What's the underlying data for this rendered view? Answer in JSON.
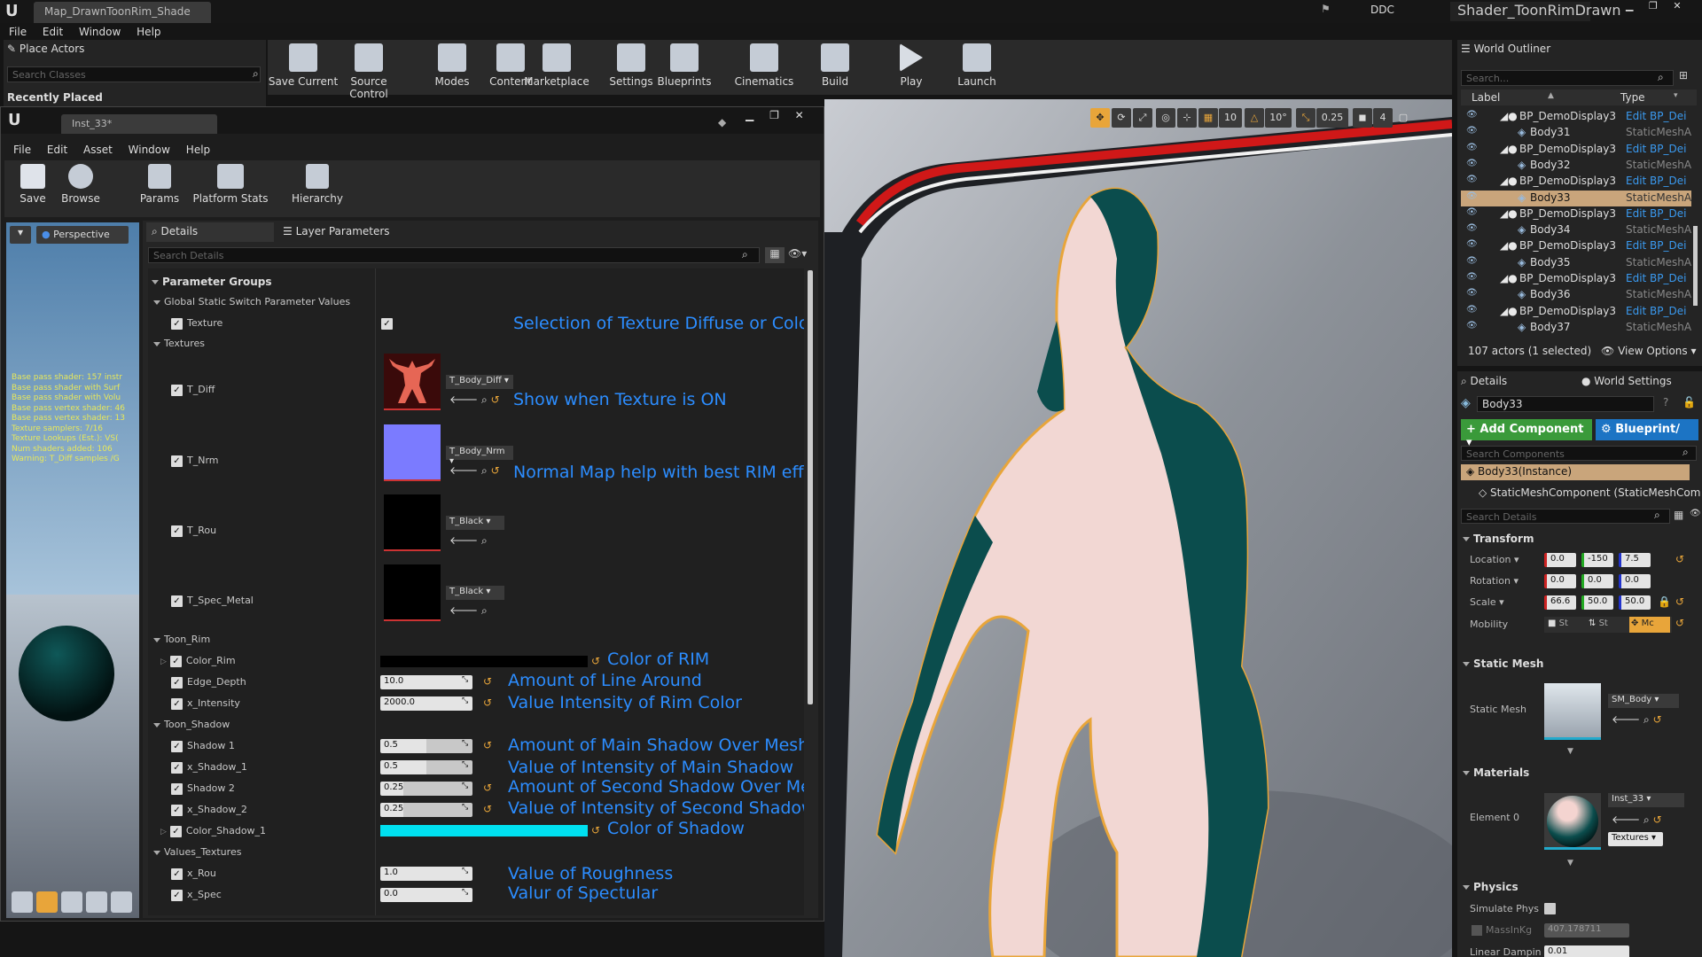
{
  "app": {
    "window_tab": "Map_DrawnToonRim_Shade",
    "ddc": "DDC",
    "project_name": "Shader_ToonRimDrawn",
    "menu": [
      "File",
      "Edit",
      "Window",
      "Help"
    ]
  },
  "place_actors": {
    "tab": "Place Actors",
    "search_placeholder": "Search Classes",
    "recently_placed": "Recently Placed"
  },
  "main_toolbar": [
    {
      "label": "Save Current",
      "icon": "save-icon"
    },
    {
      "label": "Source Control",
      "icon": "source-control-icon"
    },
    {
      "label": "Modes",
      "icon": "modes-icon"
    },
    {
      "label": "Content",
      "icon": "content-icon"
    },
    {
      "label": "Marketplace",
      "icon": "marketplace-icon"
    },
    {
      "label": "Settings",
      "icon": "settings-icon"
    },
    {
      "label": "Blueprints",
      "icon": "blueprints-icon"
    },
    {
      "label": "Cinematics",
      "icon": "cinematics-icon"
    },
    {
      "label": "Build",
      "icon": "build-icon"
    },
    {
      "label": "Play",
      "icon": "play-icon"
    },
    {
      "label": "Launch",
      "icon": "launch-icon"
    }
  ],
  "viewport_toolbar": {
    "grid": "10",
    "rotation": "10°",
    "scale": "0.25",
    "camera_speed": "4"
  },
  "material_editor": {
    "tab": "Inst_33*",
    "menu": [
      "File",
      "Edit",
      "Asset",
      "Window",
      "Help"
    ],
    "toolbar": [
      "Save",
      "Browse",
      "Params",
      "Platform Stats",
      "Hierarchy"
    ],
    "perspective": "Perspective",
    "stats": [
      "Base pass shader: 157 instr",
      "Base pass shader with Surf",
      "Base pass shader with Volu",
      "Base pass vertex shader: 46",
      "Base pass vertex shader: 13",
      "Texture samplers: 7/16",
      "Texture Lookups (Est.): VS(",
      "Num shaders added: 106",
      "Warning: T_Diff samples /G"
    ],
    "tabs": [
      "Details",
      "Layer Parameters"
    ],
    "search_placeholder": "Search Details",
    "groups": {
      "parameter_groups": "Parameter Groups",
      "global_static": "Global Static Switch Parameter Values",
      "texture": "Texture",
      "textures": "Textures",
      "t_diff": "T_Diff",
      "t_nrm": "T_Nrm",
      "t_rou": "T_Rou",
      "t_spec": "T_Spec_Metal",
      "toon_rim": "Toon_Rim",
      "color_rim": "Color_Rim",
      "edge_depth": "Edge_Depth",
      "x_intensity": "x_Intensity",
      "toon_shadow": "Toon_Shadow",
      "shadow1": "Shadow 1",
      "x_shadow1": "x_Shadow_1",
      "shadow2": "Shadow 2",
      "x_shadow2": "x_Shadow_2",
      "color_shadow1": "Color_Shadow_1",
      "values_textures": "Values_Textures",
      "x_rou": "x_Rou",
      "x_spec": "x_Spec"
    },
    "assets": {
      "diff": "T_Body_Diff",
      "nrm": "T_Body_Nrm",
      "rou": "T_Black",
      "spec": "T_Black"
    },
    "values": {
      "edge_depth": "10.0",
      "x_intensity": "2000.0",
      "shadow1": "0.5",
      "x_shadow1": "0.5",
      "shadow2": "0.25",
      "x_shadow2": "0.25",
      "x_rou": "1.0",
      "x_spec": "0.0"
    },
    "annotations": {
      "texture": "Selection of Texture Diffuse or Color",
      "diff": "Show when Texture is ON",
      "nrm": "Normal Map help with best RIM effect",
      "color_rim": "Color of RIM",
      "edge_depth": "Amount of Line Around",
      "x_intensity": "Value Intensity of Rim Color",
      "shadow1": "Amount of Main Shadow Over Mesh",
      "x_shadow1": "Value of Intensity of Main Shadow",
      "shadow2": "Amount of Second Shadow Over Mesh",
      "x_shadow2": "Value of Intensity of Second Shadow",
      "color_shadow": "Color of Shadow",
      "x_rou": "Value of Roughness",
      "x_spec": "Valur of Spectular"
    },
    "colors": {
      "rim": "#000000",
      "shadow": "#00e0f0"
    }
  },
  "world_outliner": {
    "tab": "World Outliner",
    "search_placeholder": "Search...",
    "col_label": "Label",
    "col_type": "Type",
    "rows": [
      {
        "label": "BP_DemoDisplay3",
        "type": "Edit BP_Dei",
        "parent": true
      },
      {
        "label": "Body31",
        "type": "StaticMeshA",
        "parent": false
      },
      {
        "label": "BP_DemoDisplay3",
        "type": "Edit BP_Dei",
        "parent": true
      },
      {
        "label": "Body32",
        "type": "StaticMeshA",
        "parent": false
      },
      {
        "label": "BP_DemoDisplay3",
        "type": "Edit BP_Dei",
        "parent": true
      },
      {
        "label": "Body33",
        "type": "StaticMeshA",
        "parent": false
      },
      {
        "label": "BP_DemoDisplay3",
        "type": "Edit BP_Dei",
        "parent": true
      },
      {
        "label": "Body34",
        "type": "StaticMeshA",
        "parent": false
      },
      {
        "label": "BP_DemoDisplay3",
        "type": "Edit BP_Dei",
        "parent": true
      },
      {
        "label": "Body35",
        "type": "StaticMeshA",
        "parent": false
      },
      {
        "label": "BP_DemoDisplay3",
        "type": "Edit BP_Dei",
        "parent": true
      },
      {
        "label": "Body36",
        "type": "StaticMeshA",
        "parent": false
      },
      {
        "label": "BP_DemoDisplay3",
        "type": "Edit BP_Dei",
        "parent": true
      },
      {
        "label": "Body37",
        "type": "StaticMeshA",
        "parent": false
      }
    ],
    "status": "107 actors (1 selected)",
    "view_options": "View Options"
  },
  "details": {
    "tab": "Details",
    "tab2": "World Settings",
    "name": "Body33",
    "add_component": "+ Add Component",
    "blueprint": "Blueprint/",
    "search_components": "Search Components",
    "instance": "Body33(Instance)",
    "component": "StaticMeshComponent (StaticMeshCom",
    "search_details": "Search Details",
    "transform": "Transform",
    "location_label": "Location",
    "rotation_label": "Rotation",
    "scale_label": "Scale",
    "mobility_label": "Mobility",
    "location": [
      "0.0",
      "-150",
      "7.5"
    ],
    "rotation": [
      "0.0",
      "0.0",
      "0.0"
    ],
    "scale": [
      "66.6",
      "50.0",
      "50.0"
    ],
    "mobility": [
      "St",
      "St",
      "Mc"
    ],
    "static_mesh_section": "Static Mesh",
    "static_mesh_label": "Static Mesh",
    "static_mesh": "SM_Body",
    "materials_section": "Materials",
    "element0": "Element 0",
    "material": "Inst_33",
    "textures_btn": "Textures",
    "physics_section": "Physics",
    "simulate_physics": "Simulate Phys",
    "mass_label": "MassInKg",
    "mass": "407.178711",
    "linear_damping": "Linear Dampin",
    "linear_damping_value": "0.01"
  }
}
